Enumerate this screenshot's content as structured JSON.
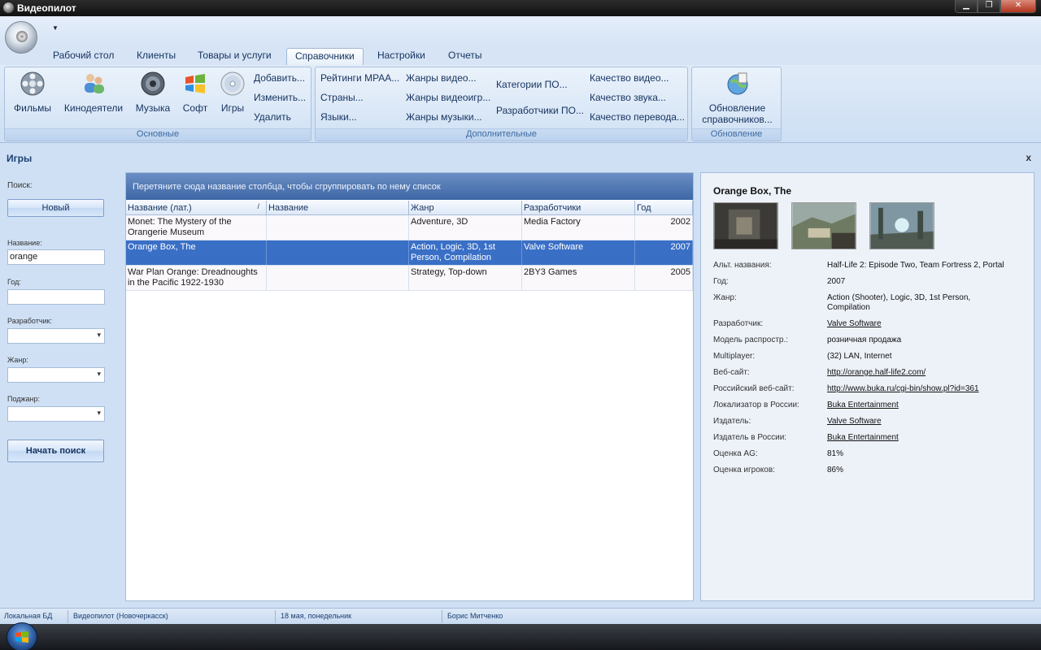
{
  "window": {
    "title": "Видеопилот"
  },
  "tabs": [
    "Рабочий стол",
    "Клиенты",
    "Товары и услуги",
    "Справочники",
    "Настройки",
    "Отчеты"
  ],
  "active_tab": "Справочники",
  "ribbon": {
    "group_main": {
      "label": "Основные",
      "buttons": [
        "Фильмы",
        "Кинодеятели",
        "Музыка",
        "Софт",
        "Игры"
      ],
      "small": [
        "Добавить...",
        "Изменить...",
        "Удалить"
      ]
    },
    "group_extra": {
      "label": "Дополнительные",
      "col1": [
        "Рейтинги MPAA...",
        "Страны...",
        "Языки..."
      ],
      "col2": [
        "Жанры видео...",
        "Жанры видеоигр...",
        "Жанры музыки..."
      ],
      "col3": [
        "Категории ПО...",
        "Разработчики ПО..."
      ],
      "col4": [
        "Качество видео...",
        "Качество звука...",
        "Качество перевода..."
      ]
    },
    "group_update": {
      "label": "Обновление",
      "button_line1": "Обновление",
      "button_line2": "справочников..."
    }
  },
  "panel": {
    "title": "Игры",
    "close": "x"
  },
  "search": {
    "search_label": "Поиск:",
    "new_button": "Новый",
    "name_label": "Название:",
    "name_value": "orange",
    "year_label": "Год:",
    "year_value": "",
    "developer_label": "Разработчик:",
    "genre_label": "Жанр:",
    "subgenre_label": "Поджанр:",
    "start_button": "Начать поиск"
  },
  "grid": {
    "group_hint": "Перетяните сюда название столбца, чтобы сгруппировать по нему список",
    "columns": [
      "Название (лат.)",
      "Название",
      "Жанр",
      "Разработчики",
      "Год"
    ],
    "sort_indicator": "/",
    "rows": [
      {
        "name_lat": "Monet: The Mystery of the Orangerie Museum",
        "name": "",
        "genre": "Adventure, 3D",
        "developers": "Media Factory",
        "year": "2002"
      },
      {
        "name_lat": "Orange Box, The",
        "name": "",
        "genre": "Action, Logic, 3D, 1st Person, Compilation",
        "developers": "Valve Software",
        "year": "2007"
      },
      {
        "name_lat": "War Plan Orange: Dreadnoughts in the Pacific 1922-1930",
        "name": "",
        "genre": "Strategy, Top-down",
        "developers": "2BY3 Games",
        "year": "2005"
      }
    ],
    "selected_row": 1
  },
  "detail": {
    "title": "Orange Box, The",
    "fields": [
      {
        "key": "Альт. названия:",
        "value": "Half-Life 2: Episode Two, Team Fortress 2, Portal",
        "link": false
      },
      {
        "key": "Год:",
        "value": "2007",
        "link": false
      },
      {
        "key": "Жанр:",
        "value": "Action (Shooter), Logic, 3D, 1st Person, Compilation",
        "link": false
      },
      {
        "key": "Разработчик:",
        "value": "Valve Software",
        "link": true
      },
      {
        "key": "Модель распростр.:",
        "value": "розничная продажа",
        "link": false
      },
      {
        "key": "Multiplayer:",
        "value": "(32) LAN, Internet",
        "link": false
      },
      {
        "key": "Веб-сайт:",
        "value": "http://orange.half-life2.com/",
        "link": true
      },
      {
        "key": "Российский веб-сайт:",
        "value": "http://www.buka.ru/cgi-bin/show.pl?id=361",
        "link": true
      },
      {
        "key": "Локализатор в России:",
        "value": "Buka Entertainment",
        "link": true
      },
      {
        "key": "Издатель:",
        "value": "Valve Software",
        "link": true
      },
      {
        "key": "Издатель в России:",
        "value": "Buka Entertainment",
        "link": true
      },
      {
        "key": "Оценка AG:",
        "value": "81%",
        "link": false
      },
      {
        "key": "Оценка игроков:",
        "value": "86%",
        "link": false
      }
    ]
  },
  "statusbar": [
    "Локальная БД",
    "Видеопилот (Новочеркасск)",
    "18 мая, понедельник",
    "Борис Митченко"
  ],
  "colors": {
    "accent": "#3a6fc6",
    "ribbon": "#dbe8f7",
    "group_header": "#4a72b0"
  }
}
